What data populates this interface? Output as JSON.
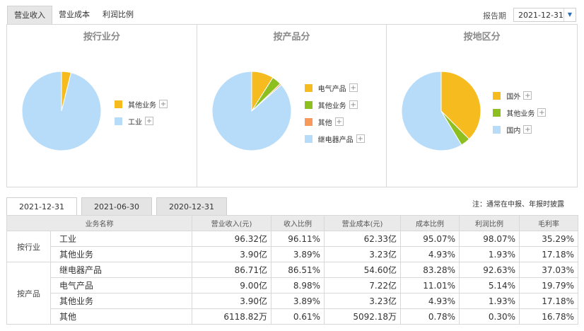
{
  "top_tabs": [
    "营业收入",
    "营业成本",
    "利润比例"
  ],
  "report_period": {
    "label": "报告期",
    "value": "2021-12-31"
  },
  "charts": [
    {
      "title": "按行业分",
      "slices": [
        {
          "name": "其他业务",
          "value": 3.89,
          "color": "#f5bb1f"
        },
        {
          "name": "工业",
          "value": 96.11,
          "color": "#b7dcfa"
        }
      ]
    },
    {
      "title": "按产品分",
      "slices": [
        {
          "name": "电气产品",
          "value": 8.98,
          "color": "#f5bb1f"
        },
        {
          "name": "其他业务",
          "value": 3.89,
          "color": "#8cbf1f"
        },
        {
          "name": "其他",
          "value": 0.61,
          "color": "#f7995a"
        },
        {
          "name": "继电器产品",
          "value": 86.51,
          "color": "#b7dcfa"
        }
      ]
    },
    {
      "title": "按地区分",
      "slices": [
        {
          "name": "国外",
          "value": 37.5,
          "color": "#f5bb1f"
        },
        {
          "name": "其他业务",
          "value": 3.89,
          "color": "#8cbf1f"
        },
        {
          "name": "国内",
          "value": 58.61,
          "color": "#b7dcfa"
        }
      ]
    }
  ],
  "period_tabs": [
    "2021-12-31",
    "2021-06-30",
    "2020-12-31"
  ],
  "note": "注：通常在中报、年报时披露",
  "table": {
    "headers": [
      "业务名称",
      "营业收入(元)",
      "收入比例",
      "营业成本(元)",
      "成本比例",
      "利润比例",
      "毛利率"
    ],
    "groups": [
      {
        "label": "按行业",
        "rows": [
          [
            "工业",
            "96.32亿",
            "96.11%",
            "62.33亿",
            "95.07%",
            "98.07%",
            "35.29%"
          ],
          [
            "其他业务",
            "3.90亿",
            "3.89%",
            "3.23亿",
            "4.93%",
            "1.93%",
            "17.18%"
          ]
        ]
      },
      {
        "label": "按产品",
        "rows": [
          [
            "继电器产品",
            "86.71亿",
            "86.51%",
            "54.60亿",
            "83.28%",
            "92.63%",
            "37.03%"
          ],
          [
            "电气产品",
            "9.00亿",
            "8.98%",
            "7.22亿",
            "11.01%",
            "5.14%",
            "19.79%"
          ],
          [
            "其他业务",
            "3.90亿",
            "3.89%",
            "3.23亿",
            "4.93%",
            "1.93%",
            "17.18%"
          ],
          [
            "其他",
            "6118.82万",
            "0.61%",
            "5092.18万",
            "0.78%",
            "0.30%",
            "16.78%"
          ]
        ]
      }
    ]
  }
}
